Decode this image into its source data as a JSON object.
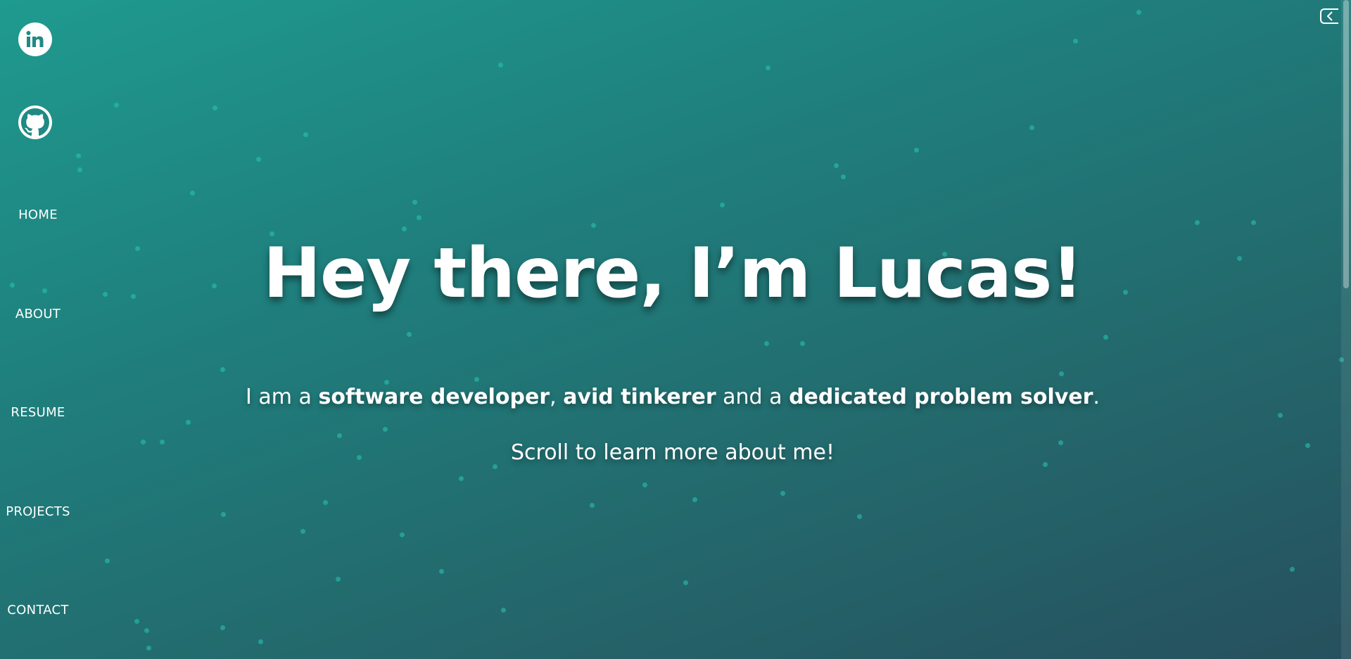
{
  "sidebar": {
    "social": [
      {
        "name": "LinkedIn",
        "icon": "linkedin-icon"
      },
      {
        "name": "GitHub",
        "icon": "github-icon"
      }
    ],
    "nav": [
      {
        "label": "HOME"
      },
      {
        "label": "ABOUT"
      },
      {
        "label": "RESUME"
      },
      {
        "label": "PROJECTS"
      },
      {
        "label": "CONTACT"
      }
    ]
  },
  "hero": {
    "title": "Hey there, I’m Lucas!",
    "subtitle": {
      "prefix": "I am a ",
      "role1": "software developer",
      "sep1": ", ",
      "role2": "avid tinkerer",
      "sep2": " and a ",
      "role3": "dedicated problem solver",
      "suffix": "."
    },
    "scroll_hint": "Scroll to learn more about me!"
  },
  "controls": {
    "collapse_icon": "chevron-left-icon"
  },
  "colors": {
    "gradient_start": "#1f9a8f",
    "gradient_end": "#26505d",
    "particle": "#28c8b4",
    "text": "#ffffff",
    "icon_fg": "#1f8a85"
  }
}
